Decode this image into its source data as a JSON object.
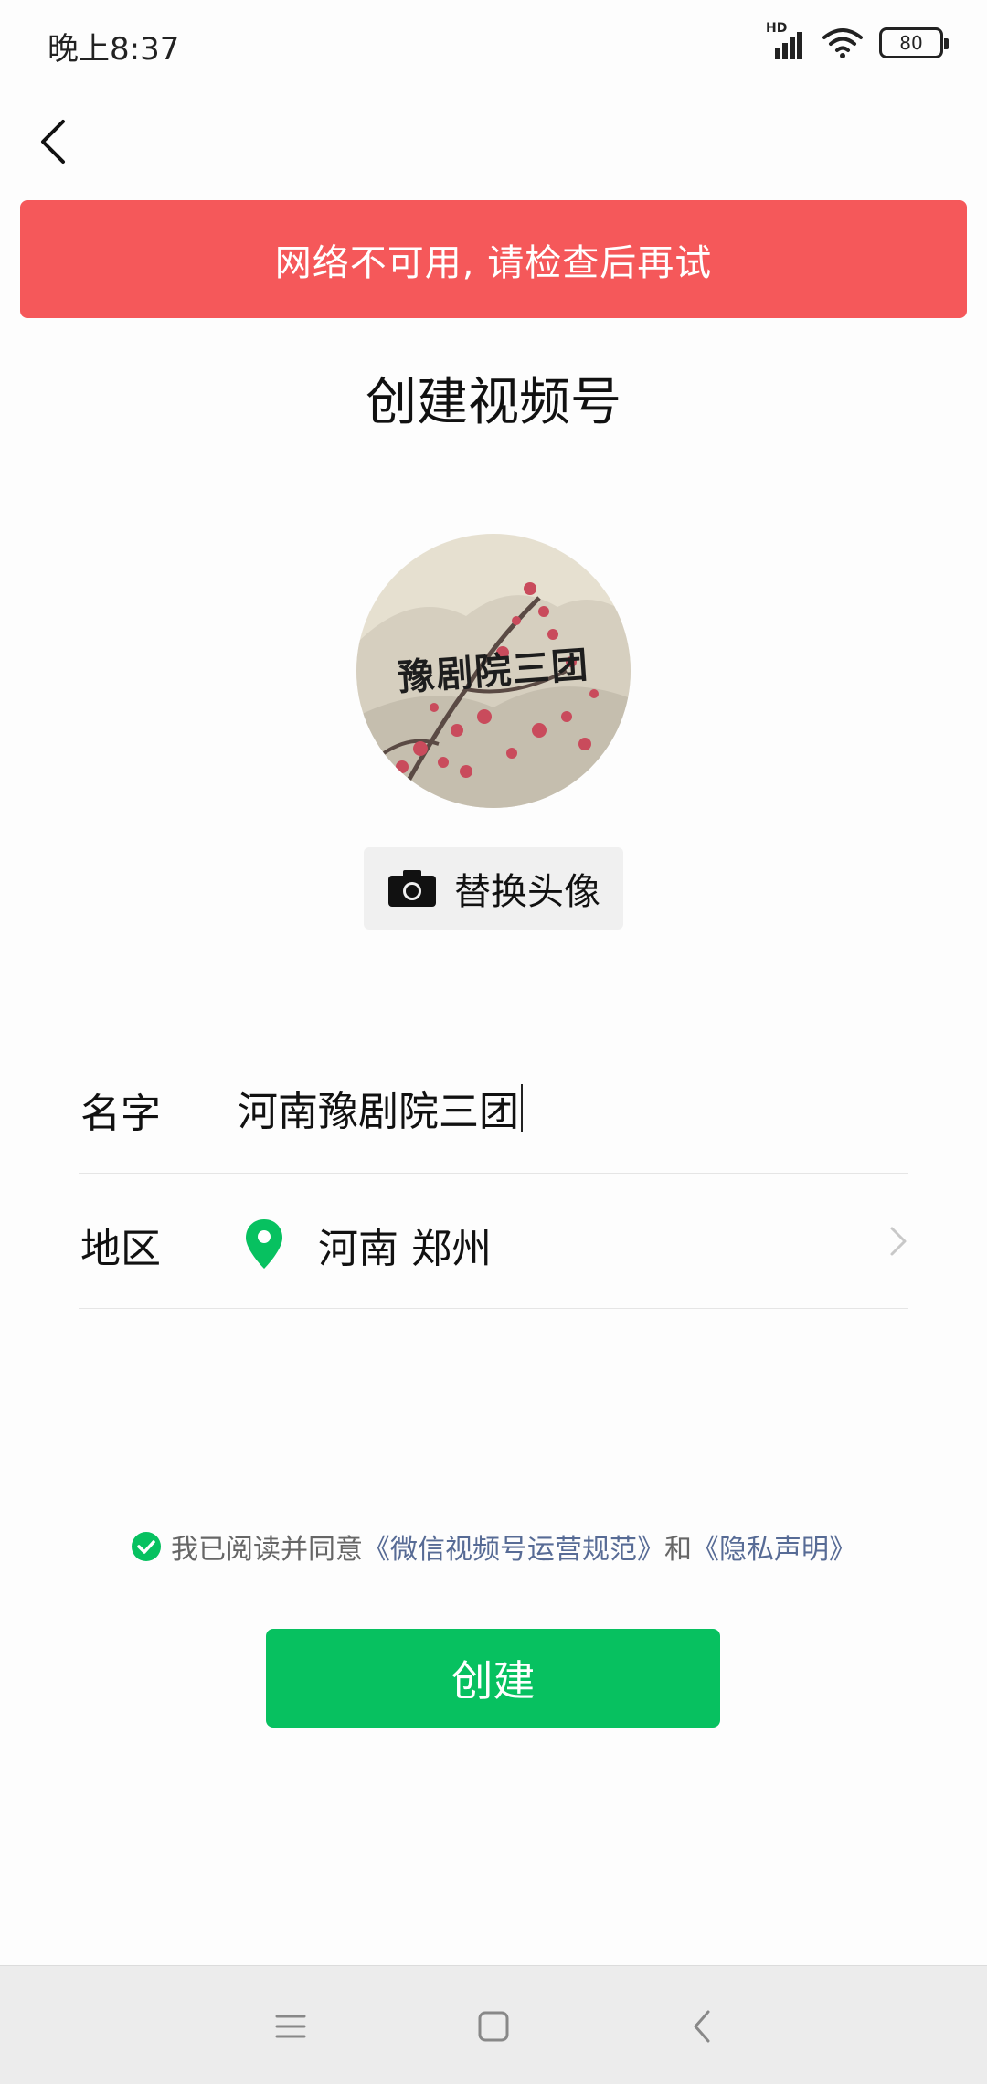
{
  "status_bar": {
    "time": "晚上8:37",
    "network_label": "HD",
    "battery_level": "80"
  },
  "banner": {
    "message": "网络不可用, 请检查后再试",
    "color": "#f5585a"
  },
  "page": {
    "title": "创建视频号"
  },
  "avatar": {
    "image_text": "豫剧院三团",
    "replace_label": "替换头像",
    "icon": "camera-icon"
  },
  "form": {
    "name_label": "名字",
    "name_value": "河南豫剧院三团",
    "region_label": "地区",
    "region_value": "河南 郑州",
    "region_icon": "location-pin-icon"
  },
  "agreement": {
    "prefix": "我已阅读并同意",
    "link_rules": "《微信视频号运营规范》",
    "conjunction": "和",
    "link_privacy": "《隐私声明》",
    "checked": true
  },
  "actions": {
    "create_label": "创建",
    "accent_color": "#07c160"
  },
  "system_nav": {
    "icons": [
      "menu-icon",
      "home-icon",
      "back-icon"
    ]
  }
}
